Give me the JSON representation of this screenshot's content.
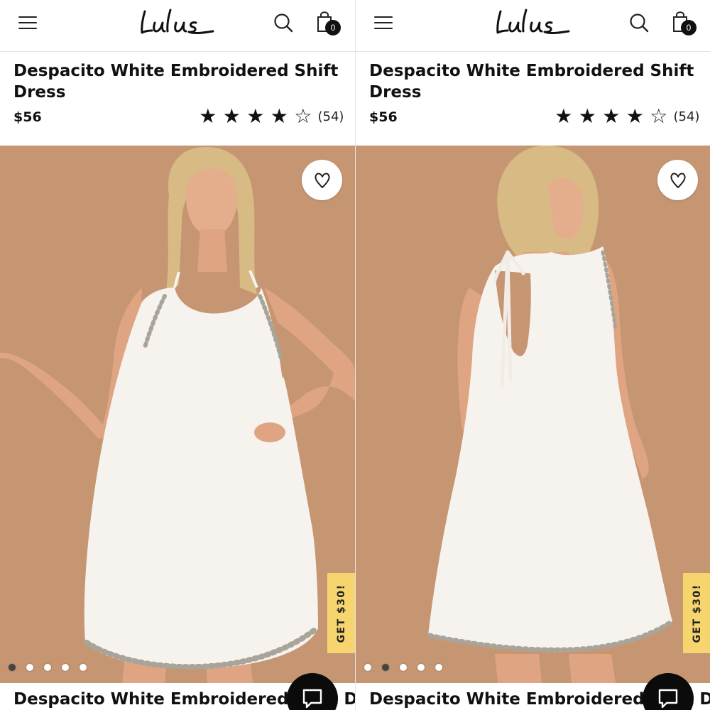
{
  "panels": [
    {
      "header": {
        "logo_text": "Lulus",
        "cart_count": "0"
      },
      "product": {
        "title": "Despacito White Embroidered Shift Dress",
        "price": "$56",
        "rating": 4,
        "rating_max": 5,
        "review_count": "(54)"
      },
      "image": {
        "view": "front",
        "active_slide": 1,
        "slide_count": 5
      },
      "promo_tab": "GET $30!",
      "next_item_title": "Despacito White Embroidered Shift Dress"
    },
    {
      "header": {
        "logo_text": "Lulus",
        "cart_count": "0"
      },
      "product": {
        "title": "Despacito White Embroidered Shift Dress",
        "price": "$56",
        "rating": 4,
        "rating_max": 5,
        "review_count": "(54)"
      },
      "image": {
        "view": "back",
        "active_slide": 2,
        "slide_count": 5
      },
      "promo_tab": "GET $30!",
      "next_item_title": "Despacito White Embroidered Shift Dress"
    }
  ],
  "icons": {
    "menu": "hamburger-icon",
    "search": "search-icon",
    "cart": "shopping-bag-icon",
    "wishlist": "heart-icon",
    "chat": "chat-bubble-icon",
    "star_filled": "★",
    "star_empty": "☆"
  },
  "colors": {
    "image_background": "#c69673",
    "promo_tab": "#f6d56f",
    "text": "#111111",
    "dress": "#f6f3ee"
  }
}
